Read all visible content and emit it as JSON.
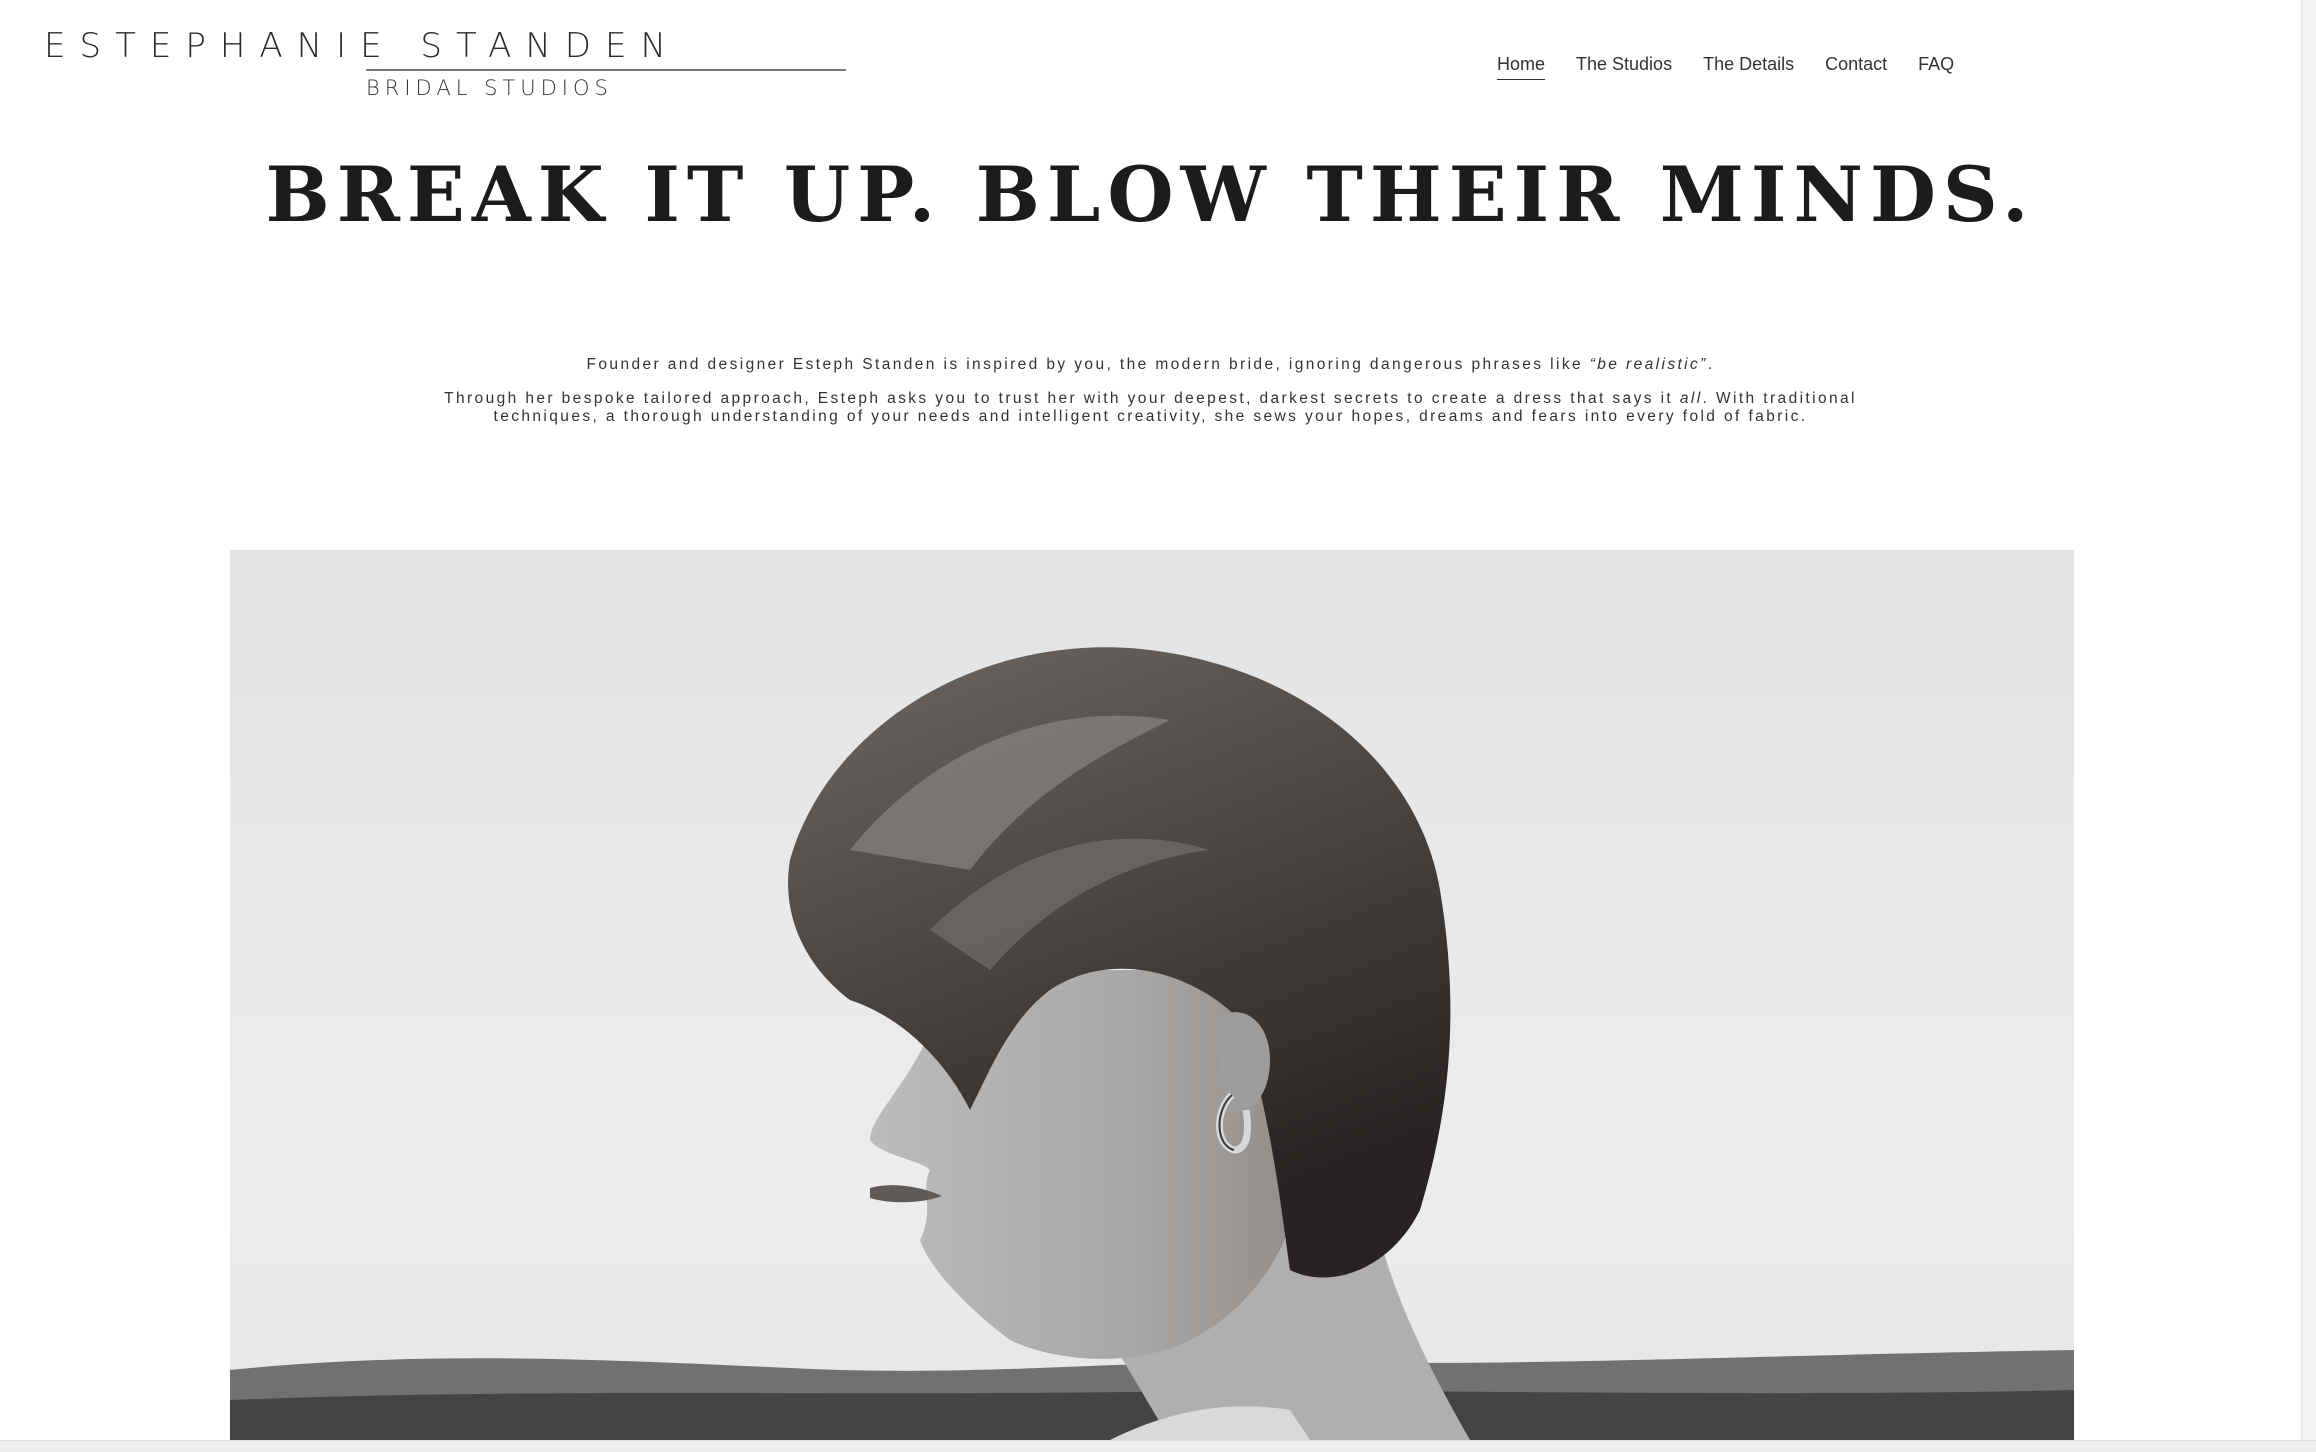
{
  "logo": {
    "line1": "ESTEPHANIE STANDEN",
    "line2": "BRIDAL STUDIOS"
  },
  "nav": {
    "items": [
      {
        "label": "Home",
        "active": true
      },
      {
        "label": "The Studios"
      },
      {
        "label": "The Details"
      },
      {
        "label": "Contact"
      },
      {
        "label": "FAQ"
      }
    ]
  },
  "hero": {
    "headline": "BREAK IT UP. BLOW THEIR MINDS.",
    "intro1_before": "Founder and designer Esteph Standen is inspired by you, the modern bride, ignoring dangerous phrases like ",
    "intro1_em": "“be realistic”",
    "intro1_after": ".",
    "intro2_line1_before": "Through her bespoke tailored approach, Esteph asks you to trust her with your deepest, darkest secrets to create a dress that says it ",
    "intro2_line1_em": "all",
    "intro2_line1_after": ". With traditional",
    "intro2_line2": "techniques, a thorough understanding of your needs and intelligent creativity, she sews your hopes, dreams and fears into every fold of fabric."
  },
  "colors": {
    "text": "#222222",
    "background": "#ffffff",
    "photo_sky": "#e8e9ea",
    "photo_hair": "#4a4542"
  }
}
